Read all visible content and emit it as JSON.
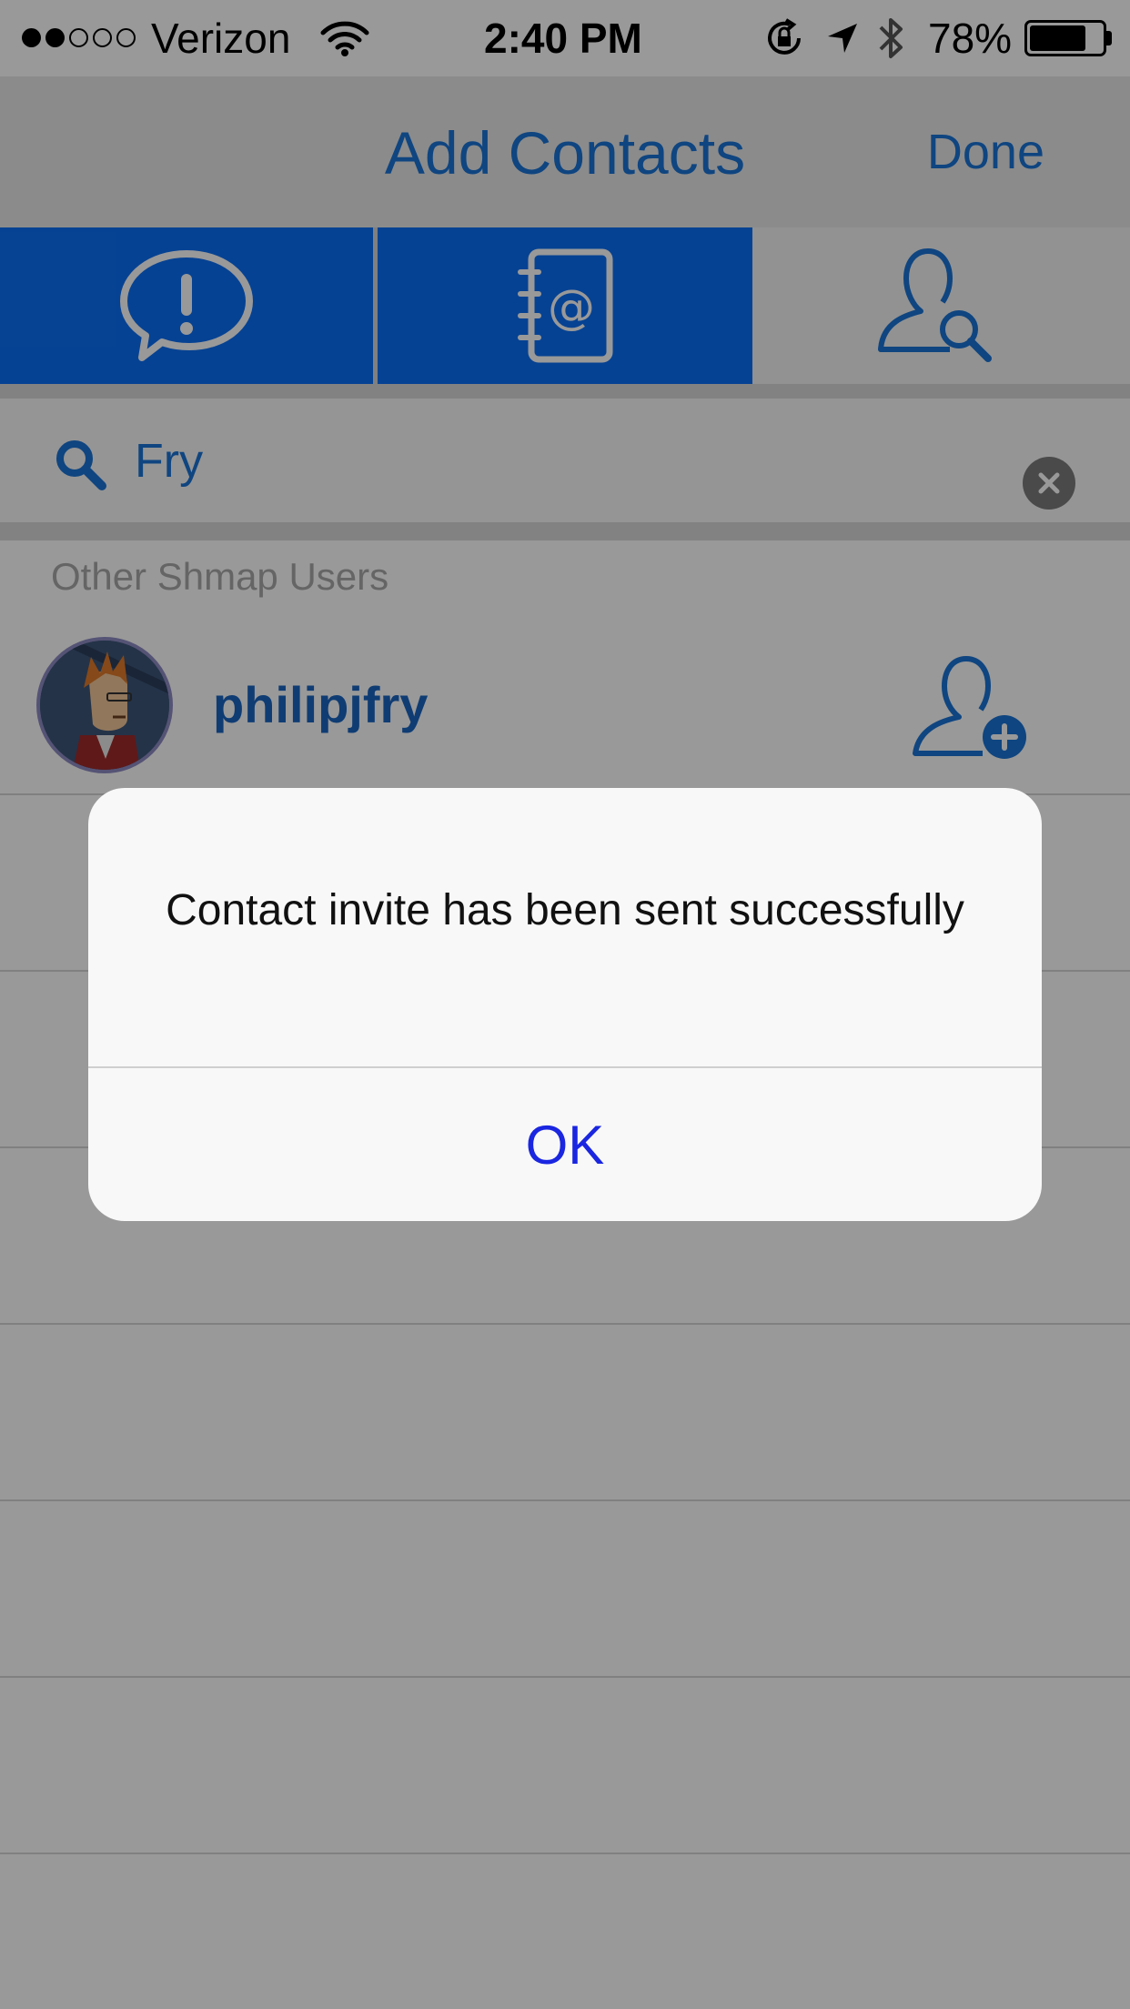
{
  "status_bar": {
    "signal_dots": [
      "full",
      "full",
      "empty",
      "empty",
      "empty"
    ],
    "carrier": "Verizon",
    "time": "2:40 PM",
    "battery_percent": "78%",
    "battery_level": 0.78
  },
  "nav": {
    "title": "Add Contacts",
    "done_label": "Done"
  },
  "tabs": [
    {
      "icon": "alert-speech-bubble-icon",
      "selected": false
    },
    {
      "icon": "address-book-icon",
      "selected": false
    },
    {
      "icon": "user-search-icon",
      "selected": true
    }
  ],
  "search": {
    "value": "Fry"
  },
  "section": {
    "header": "Other Shmap Users"
  },
  "results": [
    {
      "username": "philipjfry",
      "avatar": "avatar",
      "action_icon": "add-contact-icon"
    }
  ],
  "alert": {
    "message": "Contact invite has been sent successfully",
    "ok_label": "OK"
  },
  "colors": {
    "accent": "#1a74d6",
    "tab_blue": "#0a6ff5",
    "alert_button": "#1a26e0"
  }
}
